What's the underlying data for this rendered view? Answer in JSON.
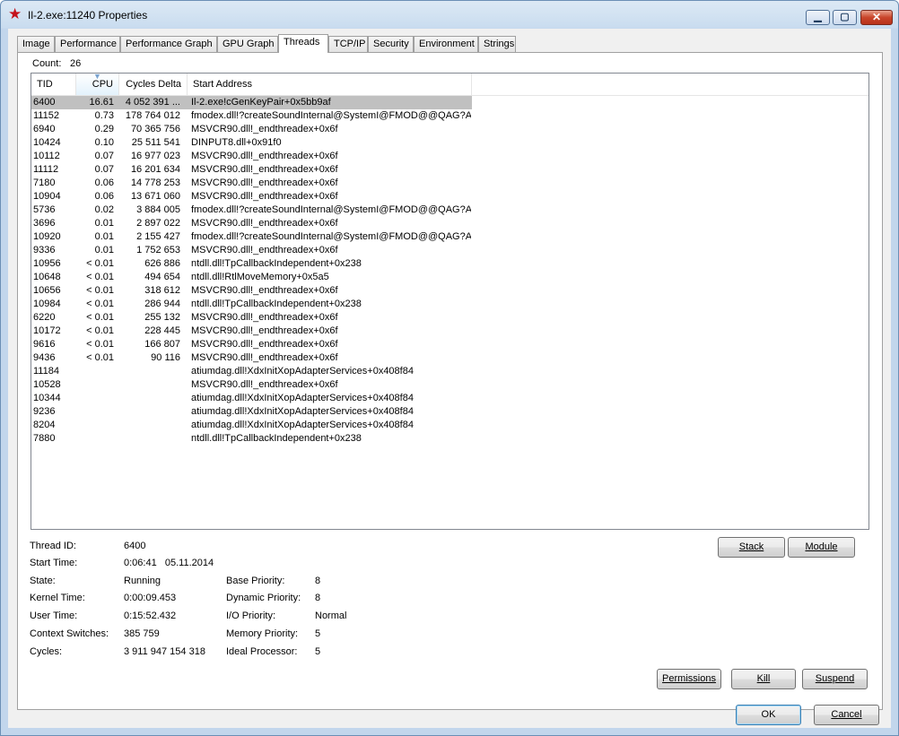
{
  "window": {
    "title": "Il-2.exe:11240 Properties",
    "icon": "red-star-icon",
    "controls": {
      "minimize": "▁",
      "maximize": "▢",
      "close": "✕"
    }
  },
  "tabs": [
    {
      "label": "Image"
    },
    {
      "label": "Performance"
    },
    {
      "label": "Performance Graph"
    },
    {
      "label": "GPU Graph"
    },
    {
      "label": "Threads",
      "active": true
    },
    {
      "label": "TCP/IP"
    },
    {
      "label": "Security"
    },
    {
      "label": "Environment"
    },
    {
      "label": "Strings"
    }
  ],
  "count": {
    "label": "Count:",
    "value": "26"
  },
  "columns": [
    "TID",
    "CPU",
    "Cycles Delta",
    "Start Address"
  ],
  "threads": [
    {
      "tid": "6400",
      "cpu": "16.61",
      "cycles": "4 052 391 ...",
      "addr": "Il-2.exe!cGenKeyPair+0x5bb9af",
      "selected": true
    },
    {
      "tid": "11152",
      "cpu": "0.73",
      "cycles": "178 764 012",
      "addr": "fmodex.dll!?createSoundInternal@SystemI@FMOD@@QAG?A..."
    },
    {
      "tid": "6940",
      "cpu": "0.29",
      "cycles": "70 365 756",
      "addr": "MSVCR90.dll!_endthreadex+0x6f"
    },
    {
      "tid": "10424",
      "cpu": "0.10",
      "cycles": "25 511 541",
      "addr": "DINPUT8.dll+0x91f0"
    },
    {
      "tid": "10112",
      "cpu": "0.07",
      "cycles": "16 977 023",
      "addr": "MSVCR90.dll!_endthreadex+0x6f"
    },
    {
      "tid": "11112",
      "cpu": "0.07",
      "cycles": "16 201 634",
      "addr": "MSVCR90.dll!_endthreadex+0x6f"
    },
    {
      "tid": "7180",
      "cpu": "0.06",
      "cycles": "14 778 253",
      "addr": "MSVCR90.dll!_endthreadex+0x6f"
    },
    {
      "tid": "10904",
      "cpu": "0.06",
      "cycles": "13 671 060",
      "addr": "MSVCR90.dll!_endthreadex+0x6f"
    },
    {
      "tid": "5736",
      "cpu": "0.02",
      "cycles": "3 884 005",
      "addr": "fmodex.dll!?createSoundInternal@SystemI@FMOD@@QAG?A..."
    },
    {
      "tid": "3696",
      "cpu": "0.01",
      "cycles": "2 897 022",
      "addr": "MSVCR90.dll!_endthreadex+0x6f"
    },
    {
      "tid": "10920",
      "cpu": "0.01",
      "cycles": "2 155 427",
      "addr": "fmodex.dll!?createSoundInternal@SystemI@FMOD@@QAG?A..."
    },
    {
      "tid": "9336",
      "cpu": "0.01",
      "cycles": "1 752 653",
      "addr": "MSVCR90.dll!_endthreadex+0x6f"
    },
    {
      "tid": "10956",
      "cpu": "< 0.01",
      "cycles": "626 886",
      "addr": "ntdll.dll!TpCallbackIndependent+0x238"
    },
    {
      "tid": "10648",
      "cpu": "< 0.01",
      "cycles": "494 654",
      "addr": "ntdll.dll!RtlMoveMemory+0x5a5"
    },
    {
      "tid": "10656",
      "cpu": "< 0.01",
      "cycles": "318 612",
      "addr": "MSVCR90.dll!_endthreadex+0x6f"
    },
    {
      "tid": "10984",
      "cpu": "< 0.01",
      "cycles": "286 944",
      "addr": "ntdll.dll!TpCallbackIndependent+0x238"
    },
    {
      "tid": "6220",
      "cpu": "< 0.01",
      "cycles": "255 132",
      "addr": "MSVCR90.dll!_endthreadex+0x6f"
    },
    {
      "tid": "10172",
      "cpu": "< 0.01",
      "cycles": "228 445",
      "addr": "MSVCR90.dll!_endthreadex+0x6f"
    },
    {
      "tid": "9616",
      "cpu": "< 0.01",
      "cycles": "166 807",
      "addr": "MSVCR90.dll!_endthreadex+0x6f"
    },
    {
      "tid": "9436",
      "cpu": "< 0.01",
      "cycles": "90 116",
      "addr": "MSVCR90.dll!_endthreadex+0x6f"
    },
    {
      "tid": "11184",
      "cpu": "",
      "cycles": "",
      "addr": "atiumdag.dll!XdxInitXopAdapterServices+0x408f84"
    },
    {
      "tid": "10528",
      "cpu": "",
      "cycles": "",
      "addr": "MSVCR90.dll!_endthreadex+0x6f"
    },
    {
      "tid": "10344",
      "cpu": "",
      "cycles": "",
      "addr": "atiumdag.dll!XdxInitXopAdapterServices+0x408f84"
    },
    {
      "tid": "9236",
      "cpu": "",
      "cycles": "",
      "addr": "atiumdag.dll!XdxInitXopAdapterServices+0x408f84"
    },
    {
      "tid": "8204",
      "cpu": "",
      "cycles": "",
      "addr": "atiumdag.dll!XdxInitXopAdapterServices+0x408f84"
    },
    {
      "tid": "7880",
      "cpu": "",
      "cycles": "",
      "addr": "ntdll.dll!TpCallbackIndependent+0x238"
    }
  ],
  "details": {
    "thread_id": {
      "label": "Thread ID:",
      "value": "6400"
    },
    "start_time": {
      "label": "Start Time:",
      "value": "0:06:41   05.11.2014"
    },
    "state": {
      "label": "State:",
      "value": "Running"
    },
    "kernel_time": {
      "label": "Kernel Time:",
      "value": "0:00:09.453"
    },
    "user_time": {
      "label": "User Time:",
      "value": "0:15:52.432"
    },
    "context_switches": {
      "label": "Context Switches:",
      "value": "385 759"
    },
    "cycles": {
      "label": "Cycles:",
      "value": "3 911 947 154 318"
    },
    "base_priority": {
      "label": "Base Priority:",
      "value": "8"
    },
    "dynamic_priority": {
      "label": "Dynamic Priority:",
      "value": "8"
    },
    "io_priority": {
      "label": "I/O Priority:",
      "value": "Normal"
    },
    "memory_priority": {
      "label": "Memory Priority:",
      "value": "5"
    },
    "ideal_processor": {
      "label": "Ideal Processor:",
      "value": "5"
    }
  },
  "buttons": {
    "stack": "Stack",
    "module": "Module",
    "permissions": "Permissions",
    "kill": "Kill",
    "suspend": "Suspend",
    "ok": "OK",
    "cancel": "Cancel"
  }
}
